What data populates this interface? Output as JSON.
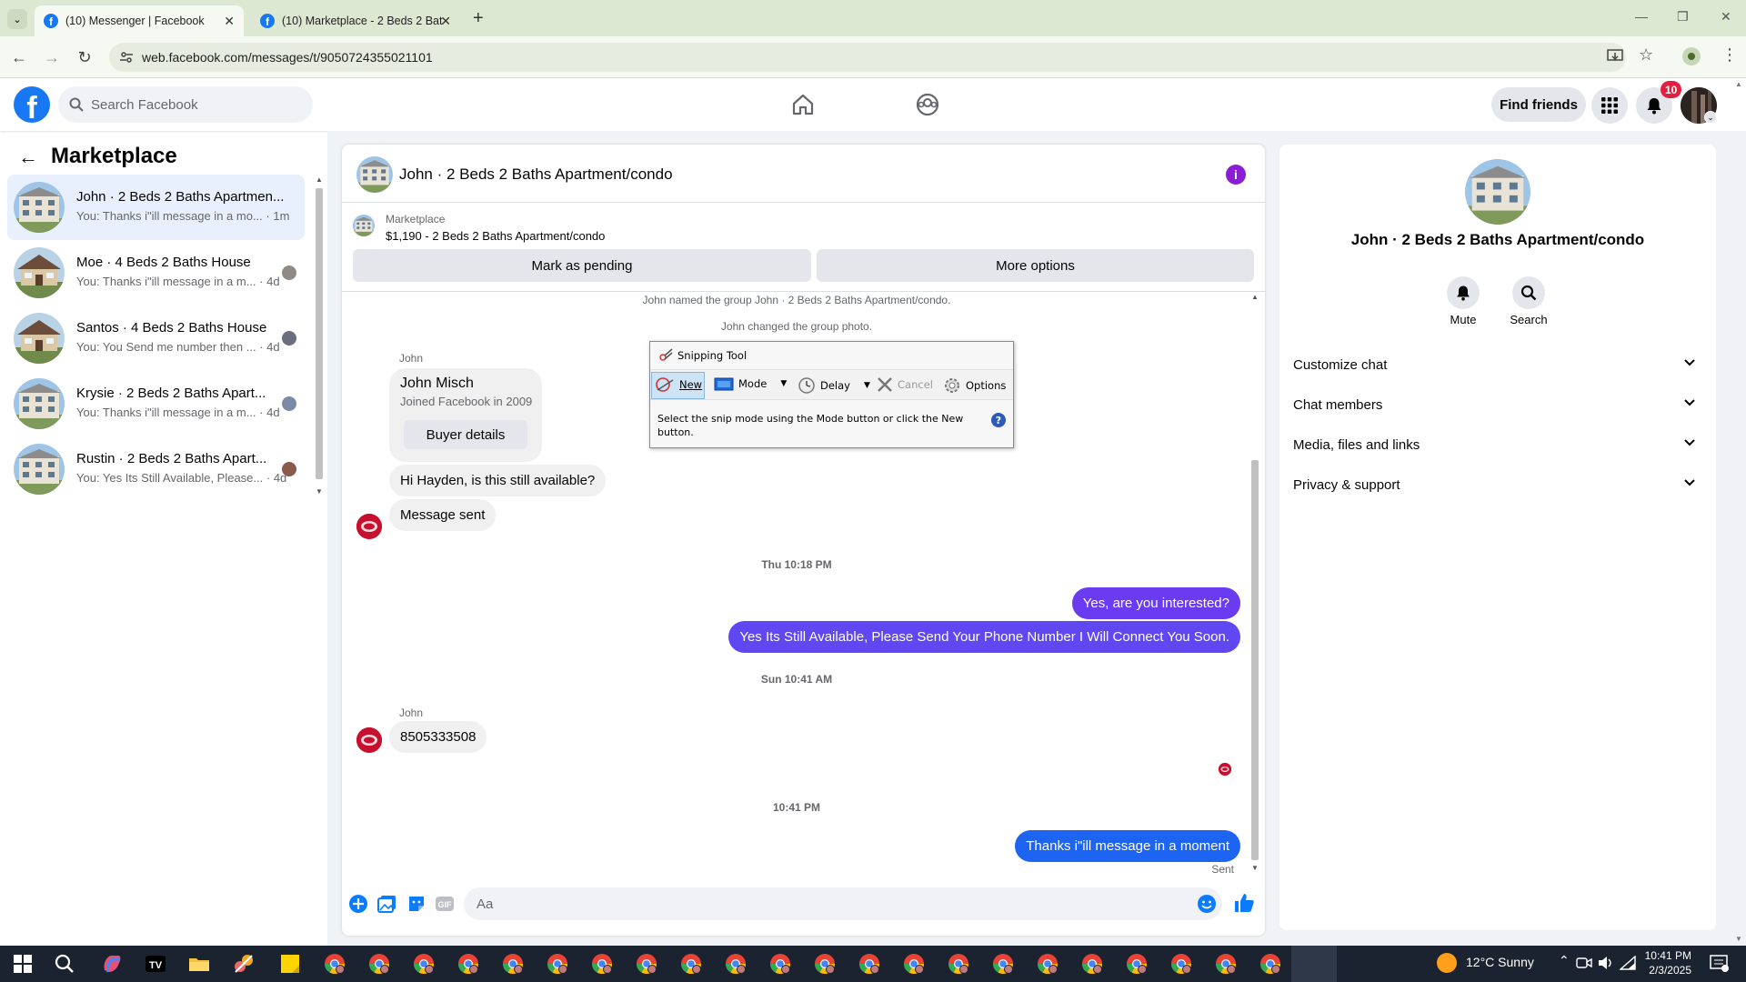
{
  "browser": {
    "tabs": [
      {
        "title": "(10) Messenger | Facebook",
        "active": true
      },
      {
        "title": "(10) Marketplace - 2 Beds 2 Bat",
        "active": false
      }
    ],
    "url": "web.facebook.com/messages/t/9050724355021101"
  },
  "fb_header": {
    "search_placeholder": "Search Facebook",
    "find_friends": "Find friends",
    "notification_count": "10"
  },
  "left_panel": {
    "title": "Marketplace",
    "conversations": [
      {
        "name": "John · 2 Beds 2 Baths Apartmen...",
        "preview": "You: Thanks i\"ill message in a mo...",
        "time": "· 1m",
        "active": true
      },
      {
        "name": "Moe · 4 Beds 2 Baths House",
        "preview": "You: Thanks i\"ill message in a m...",
        "time": "· 4d",
        "active": false
      },
      {
        "name": "Santos · 4 Beds 2 Baths House",
        "preview": "You: You Send me number then ...",
        "time": "· 4d",
        "active": false
      },
      {
        "name": "Krysie · 2 Beds 2 Baths Apart...",
        "preview": "You: Thanks i\"ill message in a m...",
        "time": "· 4d",
        "active": false
      },
      {
        "name": "Rustin · 2 Beds 2 Baths Apart...",
        "preview": "You: Yes Its Still Available, Please...",
        "time": "· 4d",
        "active": false
      }
    ]
  },
  "chat": {
    "title": "John · 2 Beds 2 Baths Apartment/condo",
    "marketplace_label": "Marketplace",
    "listing_line": "$1,190 - 2 Beds 2 Baths Apartment/condo",
    "mark_pending": "Mark as pending",
    "more_options": "More options",
    "system_messages": [
      "John named the group John · 2 Beds 2 Baths Apartment/condo.",
      "John changed the group photo."
    ],
    "sender_name": "John",
    "card": {
      "name": "John Misch",
      "joined": "Joined Facebook in 2009",
      "button": "Buyer details"
    },
    "incoming_1": "Hi Hayden, is this still available?",
    "incoming_2": "Message sent",
    "timestamp_1": "Thu 10:18 PM",
    "outgoing_1": "Yes, are you interested?",
    "outgoing_2": "Yes Its Still Available, Please Send Your Phone Number I Will Connect You Soon.",
    "timestamp_2": "Sun 10:41 AM",
    "sender_name_2": "John",
    "incoming_3": "8505333508",
    "timestamp_3": "10:41 PM",
    "outgoing_3": "Thanks i\"ill message in a moment",
    "sent_status": "Sent",
    "composer_placeholder": "Aa",
    "colors": {
      "outgoing_purple": "#6a3bf0",
      "outgoing_blue": "#1d64f2",
      "accent": "#8b1ed4"
    }
  },
  "right_panel": {
    "name": "John · 2 Beds 2 Baths Apartment/condo",
    "mute_label": "Mute",
    "search_label": "Search",
    "sections": [
      "Customize chat",
      "Chat members",
      "Media, files and links",
      "Privacy & support"
    ]
  },
  "snipping_tool": {
    "title": "Snipping Tool",
    "new": "New",
    "mode": "Mode",
    "delay": "Delay",
    "cancel": "Cancel",
    "options": "Options",
    "message": "Select the snip mode using the Mode button or click the New button.",
    "help": "?"
  },
  "taskbar": {
    "weather": "12°C  Sunny",
    "time": "10:41 PM",
    "date": "2/3/2025"
  }
}
